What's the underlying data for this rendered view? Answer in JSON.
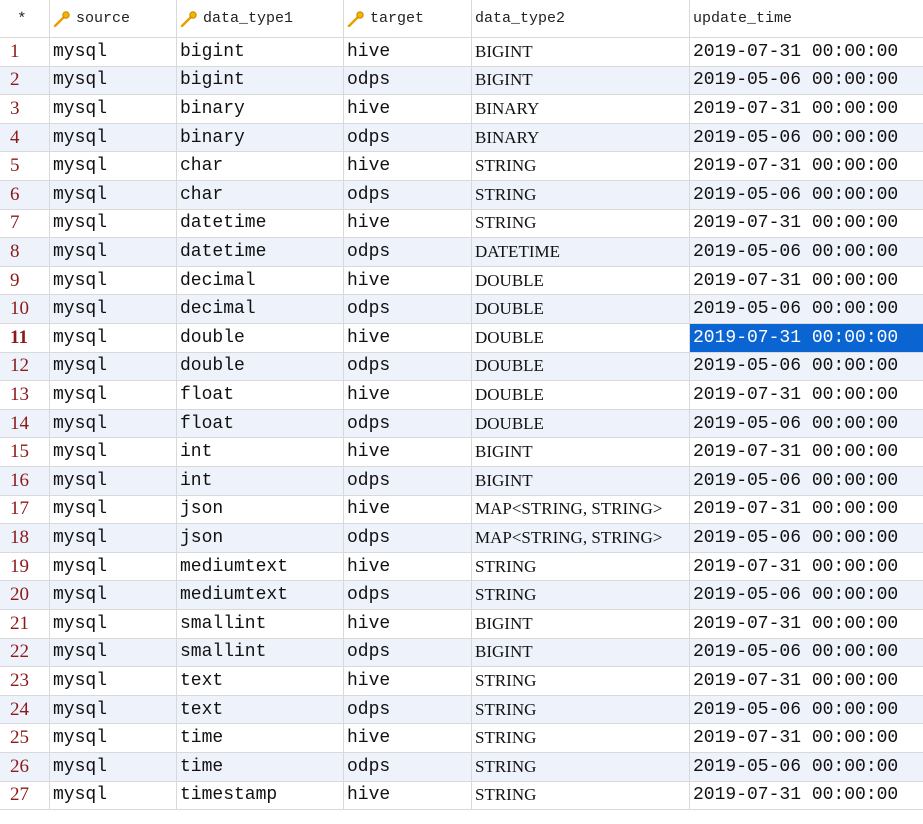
{
  "header": {
    "row_marker": "*",
    "columns": [
      {
        "label": "source",
        "icon": "key-icon"
      },
      {
        "label": "data_type1",
        "icon": "key-icon"
      },
      {
        "label": "target",
        "icon": "key-icon"
      },
      {
        "label": "data_type2",
        "icon": ""
      },
      {
        "label": "update_time",
        "icon": ""
      }
    ]
  },
  "colors": {
    "row_number": "#8b1a1a",
    "key_icon": "#e8a000",
    "selection": "#0a64d2",
    "alt_row": "#eef3fb",
    "grid_line": "#d9d9d9"
  },
  "selected": {
    "row": 11,
    "column": "update_time"
  },
  "rows": [
    {
      "n": "1",
      "source": "mysql",
      "data_type1": "bigint",
      "target": "hive",
      "data_type2": "BIGINT",
      "update_time": "2019-07-31 00:00:00"
    },
    {
      "n": "2",
      "source": "mysql",
      "data_type1": "bigint",
      "target": "odps",
      "data_type2": "BIGINT",
      "update_time": "2019-05-06 00:00:00"
    },
    {
      "n": "3",
      "source": "mysql",
      "data_type1": "binary",
      "target": "hive",
      "data_type2": "BINARY",
      "update_time": "2019-07-31 00:00:00"
    },
    {
      "n": "4",
      "source": "mysql",
      "data_type1": "binary",
      "target": "odps",
      "data_type2": "BINARY",
      "update_time": "2019-05-06 00:00:00"
    },
    {
      "n": "5",
      "source": "mysql",
      "data_type1": "char",
      "target": "hive",
      "data_type2": "STRING",
      "update_time": "2019-07-31 00:00:00"
    },
    {
      "n": "6",
      "source": "mysql",
      "data_type1": "char",
      "target": "odps",
      "data_type2": "STRING",
      "update_time": "2019-05-06 00:00:00"
    },
    {
      "n": "7",
      "source": "mysql",
      "data_type1": "datetime",
      "target": "hive",
      "data_type2": "STRING",
      "update_time": "2019-07-31 00:00:00"
    },
    {
      "n": "8",
      "source": "mysql",
      "data_type1": "datetime",
      "target": "odps",
      "data_type2": "DATETIME",
      "update_time": "2019-05-06 00:00:00"
    },
    {
      "n": "9",
      "source": "mysql",
      "data_type1": "decimal",
      "target": "hive",
      "data_type2": "DOUBLE",
      "update_time": "2019-07-31 00:00:00"
    },
    {
      "n": "10",
      "source": "mysql",
      "data_type1": "decimal",
      "target": "odps",
      "data_type2": "DOUBLE",
      "update_time": "2019-05-06 00:00:00"
    },
    {
      "n": "11",
      "source": "mysql",
      "data_type1": "double",
      "target": "hive",
      "data_type2": "DOUBLE",
      "update_time": "2019-07-31 00:00:00"
    },
    {
      "n": "12",
      "source": "mysql",
      "data_type1": "double",
      "target": "odps",
      "data_type2": "DOUBLE",
      "update_time": "2019-05-06 00:00:00"
    },
    {
      "n": "13",
      "source": "mysql",
      "data_type1": "float",
      "target": "hive",
      "data_type2": "DOUBLE",
      "update_time": "2019-07-31 00:00:00"
    },
    {
      "n": "14",
      "source": "mysql",
      "data_type1": "float",
      "target": "odps",
      "data_type2": "DOUBLE",
      "update_time": "2019-05-06 00:00:00"
    },
    {
      "n": "15",
      "source": "mysql",
      "data_type1": "int",
      "target": "hive",
      "data_type2": "BIGINT",
      "update_time": "2019-07-31 00:00:00"
    },
    {
      "n": "16",
      "source": "mysql",
      "data_type1": "int",
      "target": "odps",
      "data_type2": "BIGINT",
      "update_time": "2019-05-06 00:00:00"
    },
    {
      "n": "17",
      "source": "mysql",
      "data_type1": "json",
      "target": "hive",
      "data_type2": "MAP<STRING, STRING>",
      "update_time": "2019-07-31 00:00:00"
    },
    {
      "n": "18",
      "source": "mysql",
      "data_type1": "json",
      "target": "odps",
      "data_type2": "MAP<STRING, STRING>",
      "update_time": "2019-05-06 00:00:00"
    },
    {
      "n": "19",
      "source": "mysql",
      "data_type1": "mediumtext",
      "target": "hive",
      "data_type2": "STRING",
      "update_time": "2019-07-31 00:00:00"
    },
    {
      "n": "20",
      "source": "mysql",
      "data_type1": "mediumtext",
      "target": "odps",
      "data_type2": "STRING",
      "update_time": "2019-05-06 00:00:00"
    },
    {
      "n": "21",
      "source": "mysql",
      "data_type1": "smallint",
      "target": "hive",
      "data_type2": "BIGINT",
      "update_time": "2019-07-31 00:00:00"
    },
    {
      "n": "22",
      "source": "mysql",
      "data_type1": "smallint",
      "target": "odps",
      "data_type2": "BIGINT",
      "update_time": "2019-05-06 00:00:00"
    },
    {
      "n": "23",
      "source": "mysql",
      "data_type1": "text",
      "target": "hive",
      "data_type2": "STRING",
      "update_time": "2019-07-31 00:00:00"
    },
    {
      "n": "24",
      "source": "mysql",
      "data_type1": "text",
      "target": "odps",
      "data_type2": "STRING",
      "update_time": "2019-05-06 00:00:00"
    },
    {
      "n": "25",
      "source": "mysql",
      "data_type1": "time",
      "target": "hive",
      "data_type2": "STRING",
      "update_time": "2019-07-31 00:00:00"
    },
    {
      "n": "26",
      "source": "mysql",
      "data_type1": "time",
      "target": "odps",
      "data_type2": "STRING",
      "update_time": "2019-05-06 00:00:00"
    },
    {
      "n": "27",
      "source": "mysql",
      "data_type1": "timestamp",
      "target": "hive",
      "data_type2": "STRING",
      "update_time": "2019-07-31 00:00:00"
    }
  ]
}
